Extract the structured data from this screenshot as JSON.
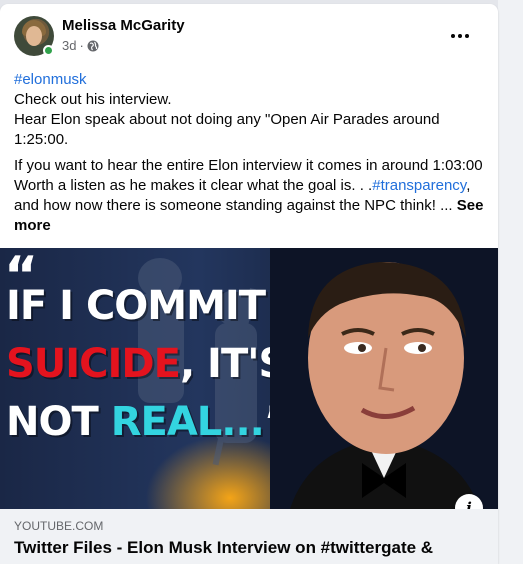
{
  "post": {
    "author": "Melissa McGarity",
    "time": "3d",
    "time_sep": "·",
    "more_icon": "more-horizontal-icon",
    "privacy_icon": "globe-icon"
  },
  "text": {
    "hashtag": "#elonmusk",
    "line1": "Check out his interview.",
    "line2": "Hear Elon speak about not doing any \"Open Air Parades around 1:25:00.",
    "para2_a": "If you want to hear the entire Elon interview it comes in around 1:03:00 Worth a listen as he makes it clear what the goal is. . .",
    "para2_tag": "#transparency",
    "para2_b": ", and how now there is someone standing against the NPC think! ... ",
    "see_more": "See more"
  },
  "media": {
    "quote_open": "“",
    "line1": "IF I COMMIT",
    "line2_red": "SUICIDE",
    "line2_white": ", IT'S",
    "line3_white": "NOT ",
    "line3_cyan": "REAL...",
    "quote_close": "”",
    "info_label": "i",
    "colors": {
      "red": "#e4131e",
      "cyan": "#33d4e0"
    }
  },
  "link": {
    "domain": "YOUTUBE.COM",
    "title": "Twitter Files - Elon Musk Interview on #twittergate &"
  }
}
